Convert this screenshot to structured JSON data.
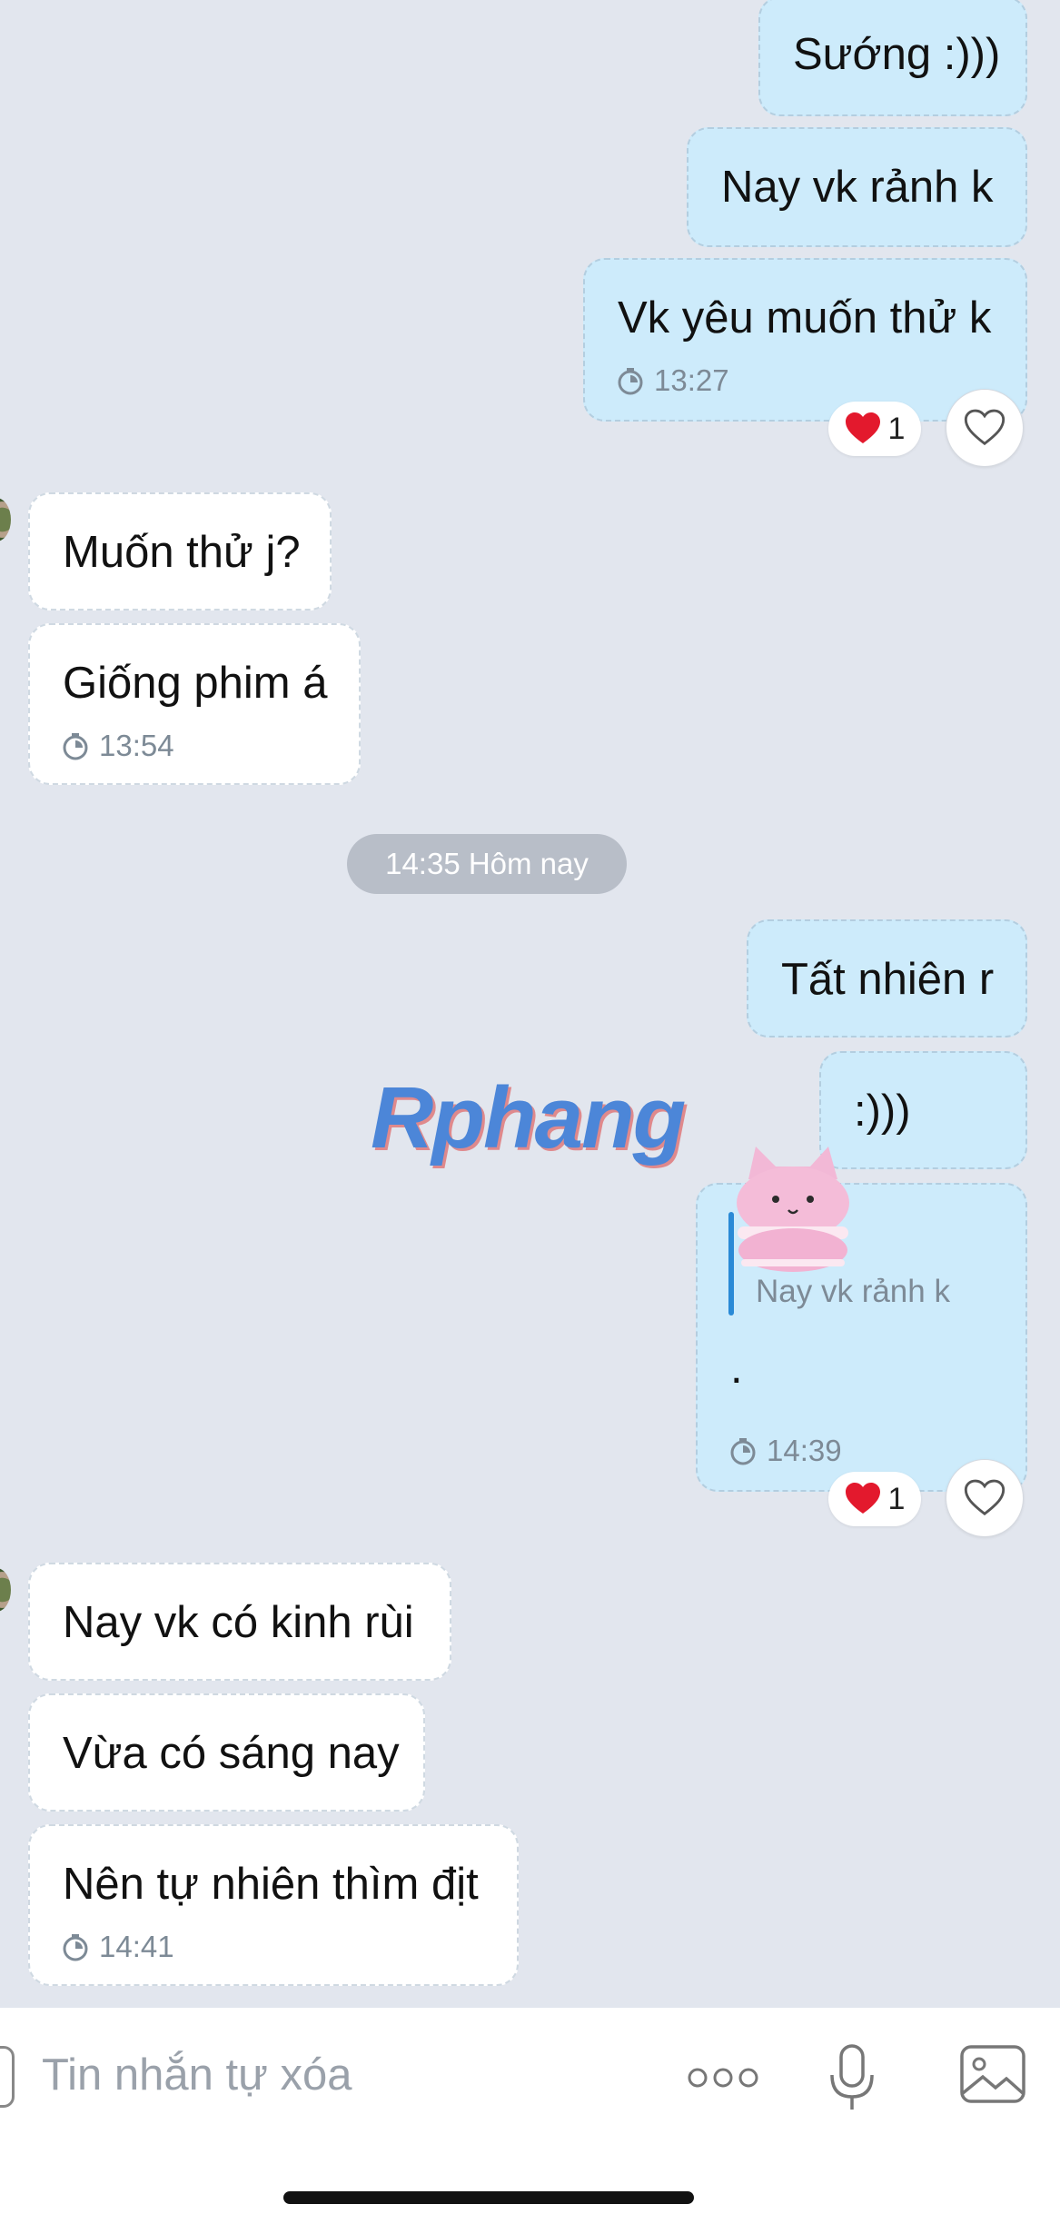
{
  "messages": [
    {
      "text": "Sướng :)))"
    },
    {
      "text": "Nay vk rảnh k"
    },
    {
      "text": "Vk yêu muốn thử k",
      "time": "13:27",
      "reaction_count": "1"
    },
    {
      "text": "Muốn thử j?"
    },
    {
      "text": "Giống phim á",
      "time": "13:54"
    },
    {
      "text": "Tất nhiên r"
    },
    {
      "text": ":)))"
    },
    {
      "quote": "Nay vk rảnh k",
      "text": ".",
      "time": "14:39",
      "reaction_count": "1"
    },
    {
      "text": "Nay vk có kinh rùi"
    },
    {
      "text": "Vừa có sáng nay"
    },
    {
      "text": "Nên tự nhiên thìm địt",
      "time": "14:41"
    }
  ],
  "date_separator": "14:35 Hôm nay",
  "watermark": "Rphang",
  "input": {
    "placeholder": "Tin nhắn tự xóa"
  },
  "icons": [
    "timer-icon",
    "heart-reaction-icon",
    "heart-outline-icon",
    "more-dots-icon",
    "microphone-icon",
    "image-icon",
    "cat-sticker"
  ],
  "colors": {
    "background": "#e2e6ee",
    "my_bubble": "#cdebfb",
    "their_bubble": "#ffffff",
    "accent": "#2a8ad6"
  }
}
